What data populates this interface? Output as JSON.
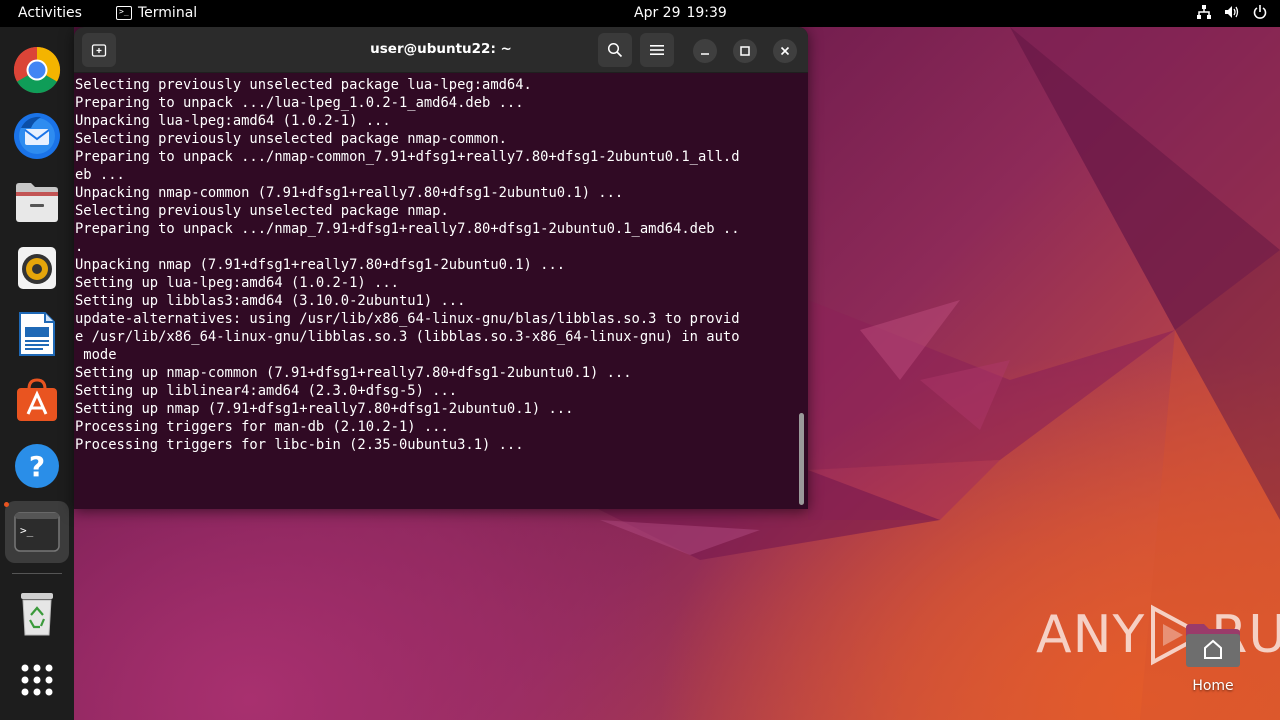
{
  "topbar": {
    "activities": "Activities",
    "app_name": "Terminal",
    "date": "Apr 29",
    "time": "19:39"
  },
  "dock": {
    "items": [
      "Google Chrome",
      "Thunderbird Mail",
      "Files",
      "Rhythmbox",
      "LibreOffice Writer",
      "Ubuntu Software",
      "Help",
      "Terminal",
      "Trash",
      "Show Applications"
    ]
  },
  "terminal": {
    "title": "user@ubuntu22: ~",
    "lines": [
      "Selecting previously unselected package lua-lpeg:amd64.",
      "Preparing to unpack .../lua-lpeg_1.0.2-1_amd64.deb ...",
      "Unpacking lua-lpeg:amd64 (1.0.2-1) ...",
      "Selecting previously unselected package nmap-common.",
      "Preparing to unpack .../nmap-common_7.91+dfsg1+really7.80+dfsg1-2ubuntu0.1_all.d",
      "eb ...",
      "Unpacking nmap-common (7.91+dfsg1+really7.80+dfsg1-2ubuntu0.1) ...",
      "Selecting previously unselected package nmap.",
      "Preparing to unpack .../nmap_7.91+dfsg1+really7.80+dfsg1-2ubuntu0.1_amd64.deb ..",
      ".",
      "Unpacking nmap (7.91+dfsg1+really7.80+dfsg1-2ubuntu0.1) ...",
      "Setting up lua-lpeg:amd64 (1.0.2-1) ...",
      "Setting up libblas3:amd64 (3.10.0-2ubuntu1) ...",
      "update-alternatives: using /usr/lib/x86_64-linux-gnu/blas/libblas.so.3 to provid",
      "e /usr/lib/x86_64-linux-gnu/libblas.so.3 (libblas.so.3-x86_64-linux-gnu) in auto",
      " mode",
      "Setting up nmap-common (7.91+dfsg1+really7.80+dfsg1-2ubuntu0.1) ...",
      "Setting up liblinear4:amd64 (2.3.0+dfsg-5) ...",
      "Setting up nmap (7.91+dfsg1+really7.80+dfsg1-2ubuntu0.1) ...",
      "Processing triggers for man-db (2.10.2-1) ...",
      "Processing triggers for libc-bin (2.35-0ubuntu3.1) ..."
    ]
  },
  "desktop": {
    "home_label": "Home"
  },
  "watermark": {
    "left": "ANY",
    "right": "RUN"
  },
  "colors": {
    "terminal_bg": "#300a24",
    "headerbar_bg": "#2b2b2b",
    "accent": "#e95420"
  }
}
